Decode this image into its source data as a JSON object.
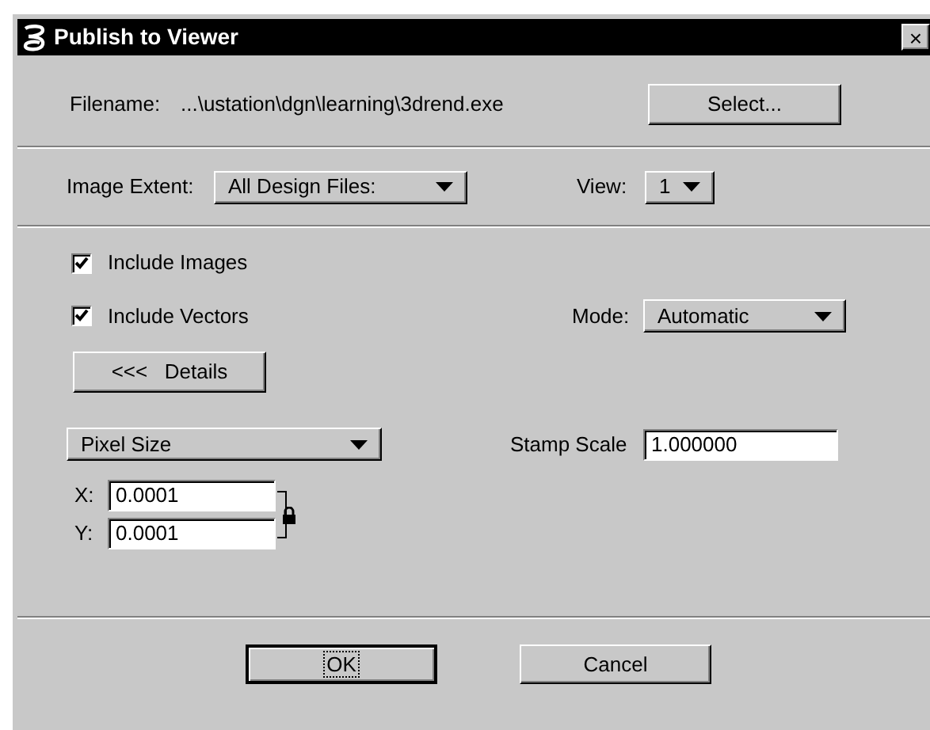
{
  "window": {
    "title": "Publish to Viewer",
    "close": "×"
  },
  "filename": {
    "label": "Filename:",
    "value": "...\\ustation\\dgn\\learning\\3drend.exe",
    "button": "Select..."
  },
  "image_extent": {
    "label": "Image Extent:",
    "value": "All Design Files:"
  },
  "view": {
    "label": "View:",
    "value": "1"
  },
  "options": [
    {
      "label": "Include Images",
      "checked": true
    },
    {
      "label": "Include Vectors",
      "checked": true
    }
  ],
  "mode": {
    "label": "Mode:",
    "value": "Automatic"
  },
  "details_button": "<<<   Details",
  "size_mode": {
    "value": "Pixel Size"
  },
  "stamp_scale": {
    "label": "Stamp Scale",
    "value": "1.000000"
  },
  "x": {
    "label": "X:",
    "value": "0.0001"
  },
  "y": {
    "label": "Y:",
    "value": "0.0001"
  },
  "lock": {
    "on": true
  },
  "buttons": [
    {
      "label": "OK",
      "selected": true
    },
    {
      "label": "Cancel",
      "selected": false
    }
  ]
}
